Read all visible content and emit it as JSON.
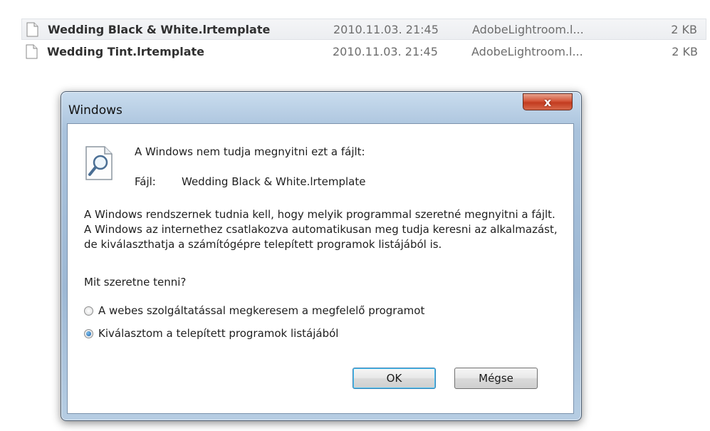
{
  "files": [
    {
      "name": "Wedding Black & White.lrtemplate",
      "date": "2010.11.03. 21:45",
      "type": "AdobeLightroom.l...",
      "size": "2 KB"
    },
    {
      "name": "Wedding Tint.lrtemplate",
      "date": "2010.11.03. 21:45",
      "type": "AdobeLightroom.l...",
      "size": "2 KB"
    }
  ],
  "dialog": {
    "title": "Windows",
    "close_label": "x",
    "message": "A Windows nem tudja megnyitni ezt a fájlt:",
    "file_label": "Fájl:",
    "file_value": "Wedding Black & White.lrtemplate",
    "explanation": "A Windows rendszernek tudnia kell, hogy melyik programmal szeretné megnyitni a fájlt. A Windows az internethez csatlakozva automatikusan meg tudja keresni az alkalmazást, de kiválaszthatja a számítógépre telepített programok listájából is.",
    "question": "Mit szeretne tenni?",
    "options": [
      {
        "label": "A webes szolgáltatással megkeresem a megfelelő programot",
        "checked": false
      },
      {
        "label": "Kiválasztom a telepített programok listájából",
        "checked": true
      }
    ],
    "ok_label": "OK",
    "cancel_label": "Mégse"
  }
}
